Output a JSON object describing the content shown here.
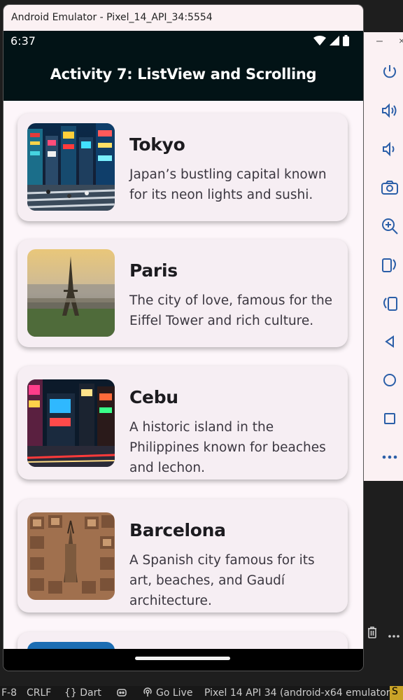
{
  "emulator": {
    "window_title": "Android Emulator - Pixel_14_API_34:5554"
  },
  "statusbar": {
    "time": "6:37"
  },
  "appbar": {
    "title": "Activity 7: ListView and Scrolling"
  },
  "cities": [
    {
      "name": "Tokyo",
      "description": "Japan’s bustling capital known for its neon lights and sushi.",
      "image": "tokyo-street-night-photo"
    },
    {
      "name": "Paris",
      "description": "The city of love, famous for the Eiffel Tower and rich culture.",
      "image": "eiffel-tower-photo"
    },
    {
      "name": "Cebu",
      "description": "A historic island in the Philippines known for beaches and lechon.",
      "image": "city-street-night-photo"
    },
    {
      "name": "Barcelona",
      "description": "A Spanish city famous for its art, beaches, and Gaudí architecture.",
      "image": "barcelona-aerial-photo"
    }
  ],
  "side_toolbar": {
    "window_controls": [
      "minimize-icon",
      "close-icon"
    ],
    "buttons": [
      "power-icon",
      "volume-up-icon",
      "volume-down-icon",
      "camera-icon",
      "zoom-icon",
      "rotate-left-icon",
      "rotate-right-icon",
      "back-icon",
      "home-icon",
      "overview-icon",
      "more-icon"
    ]
  },
  "ide_status": {
    "encoding": "F-8",
    "line_ending": "CRLF",
    "language": "{} Dart",
    "go_live": "Go Live",
    "device": "Pixel 14 API 34 (android-x64 emulator)",
    "tail": "S"
  },
  "colors": {
    "appbar": "#021316",
    "background": "#fdf6fa",
    "card": "#f6eef3"
  }
}
